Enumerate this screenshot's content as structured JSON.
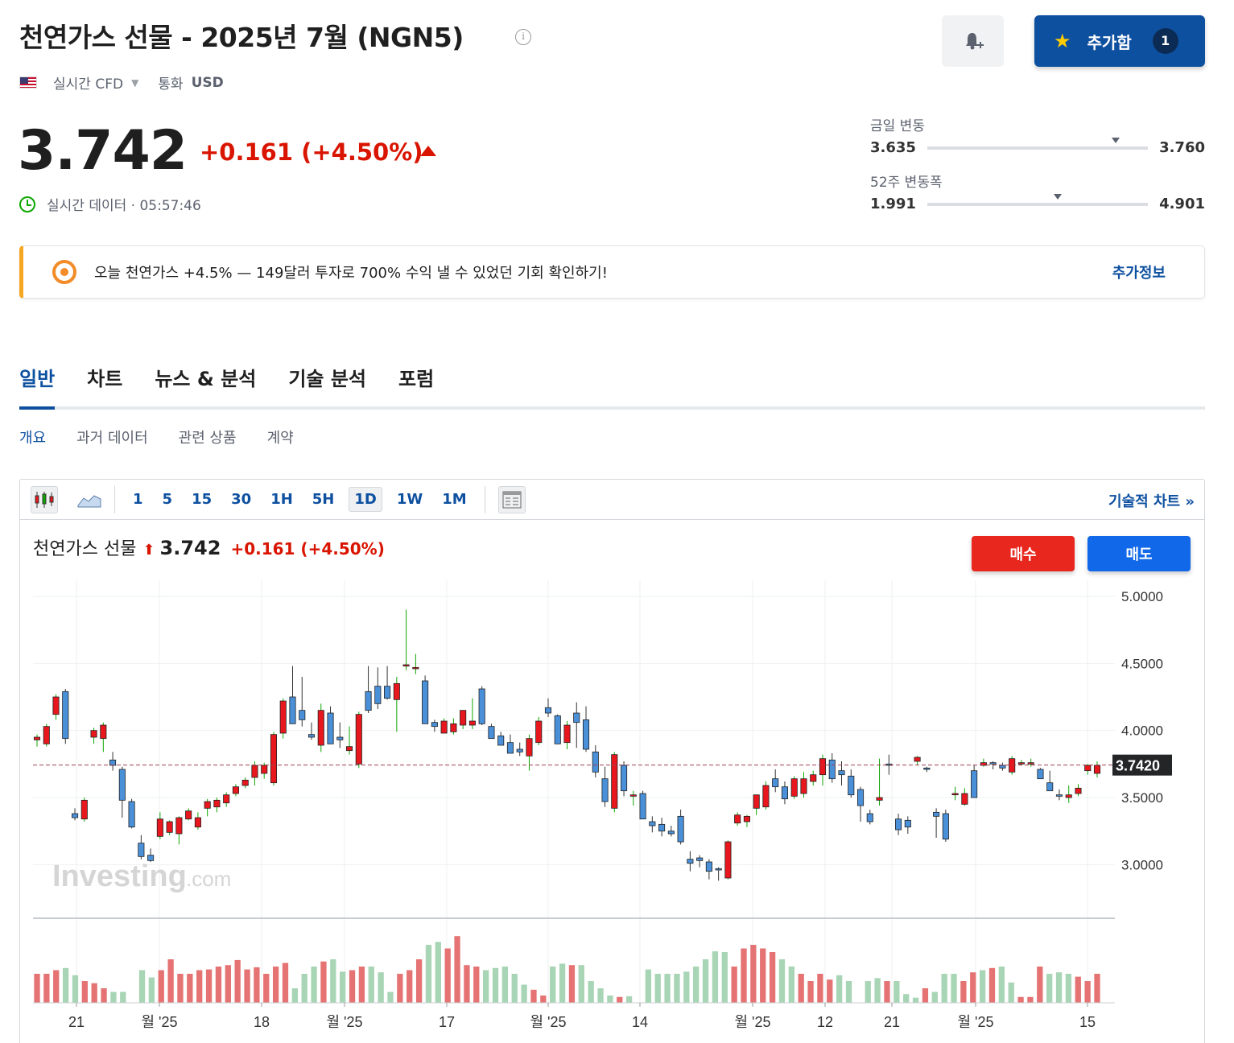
{
  "header": {
    "title": "천연가스 선물 - 2025년 7월 (NGN5)",
    "info_icon": "info-icon",
    "alert_icon": "bell-plus-icon",
    "watchlist_label": "추가함",
    "watchlist_count": "1",
    "watchlist_icon": "star-icon"
  },
  "subinfo": {
    "flag_icon": "us-flag-icon",
    "source": "실시간 CFD",
    "currency_label": "통화",
    "currency": "USD"
  },
  "quote": {
    "price": "3.742",
    "change": "+0.161 (+4.50%)",
    "realtime_label": "실시간 데이터 · 05:57:46"
  },
  "ranges": {
    "day_label": "금일 변동",
    "day_low": "3.635",
    "day_high": "3.760",
    "day_marker_fraction": 0.855,
    "week52_label": "52주 변동폭",
    "week52_low": "1.991",
    "week52_high": "4.901",
    "week52_marker_fraction": 0.59
  },
  "promo": {
    "text": "오늘 천연가스 +4.5% — 149달러 투자로 700% 수익 낼 수 있었던 기회 확인하기!",
    "link": "추가정보",
    "accent": "#f5a623"
  },
  "tabs": [
    "일반",
    "차트",
    "뉴스 & 분석",
    "기술 분석",
    "포럼"
  ],
  "subtabs": [
    "개요",
    "과거 데이터",
    "관련 상품",
    "계약"
  ],
  "chart_toolbar": {
    "timeframes": [
      "1",
      "5",
      "15",
      "30",
      "1H",
      "5H",
      "1D",
      "1W",
      "1M"
    ],
    "active_timeframe": "1D",
    "tech_chart_link": "기술적 차트 »"
  },
  "chart_header": {
    "name": "천연가스 선물",
    "price": "3.742",
    "change": "+0.161 (+4.50%)",
    "buy_label": "매수",
    "sell_label": "매도"
  },
  "colors": {
    "up_candle": "#e8171e",
    "down_candle": "#4a90d9",
    "volume_up": "#a8d5b5",
    "volume_down": "#e57373",
    "brand_blue": "#0e50a0",
    "change_red": "#d91400"
  },
  "chart_data": {
    "type": "candlestick",
    "y_ticks": [
      "5.0000",
      "4.5000",
      "4.0000",
      "3.5000",
      "3.0000"
    ],
    "y_range": [
      2.6,
      5.12
    ],
    "current_price_label": "3.7420",
    "current_price": 3.742,
    "x_tick_labels": [
      "21",
      "월 '25",
      "18",
      "월 '25",
      "17",
      "월 '25",
      "14",
      "월 '25",
      "12",
      "21",
      "월 '25",
      "15"
    ],
    "watermark": "Investing.com",
    "ohlc": [
      [
        3.93,
        3.97,
        3.88,
        3.95
      ],
      [
        3.9,
        4.05,
        3.88,
        4.03
      ],
      [
        4.12,
        4.27,
        4.08,
        4.25
      ],
      [
        4.29,
        4.31,
        3.9,
        3.94
      ],
      [
        3.38,
        3.42,
        3.33,
        3.35
      ],
      [
        3.34,
        3.5,
        3.32,
        3.48
      ],
      [
        3.95,
        4.02,
        3.9,
        4.0
      ],
      [
        3.94,
        4.06,
        3.84,
        4.04
      ],
      [
        3.78,
        3.84,
        3.7,
        3.74
      ],
      [
        3.71,
        3.73,
        3.35,
        3.48
      ],
      [
        3.47,
        3.49,
        3.27,
        3.28
      ],
      [
        3.16,
        3.22,
        3.04,
        3.06
      ],
      [
        3.07,
        3.12,
        3.02,
        3.03
      ],
      [
        3.21,
        3.39,
        3.19,
        3.34
      ],
      [
        3.24,
        3.33,
        3.22,
        3.32
      ],
      [
        3.23,
        3.36,
        3.15,
        3.35
      ],
      [
        3.34,
        3.42,
        3.33,
        3.4
      ],
      [
        3.28,
        3.39,
        3.26,
        3.35
      ],
      [
        3.42,
        3.49,
        3.36,
        3.47
      ],
      [
        3.43,
        3.5,
        3.39,
        3.48
      ],
      [
        3.46,
        3.54,
        3.43,
        3.52
      ],
      [
        3.53,
        3.6,
        3.51,
        3.58
      ],
      [
        3.59,
        3.65,
        3.57,
        3.63
      ],
      [
        3.65,
        3.77,
        3.59,
        3.74
      ],
      [
        3.68,
        3.76,
        3.64,
        3.74
      ],
      [
        3.61,
        3.99,
        3.59,
        3.97
      ],
      [
        3.98,
        4.24,
        3.94,
        4.22
      ],
      [
        4.25,
        4.48,
        4.2,
        4.05
      ],
      [
        4.15,
        4.4,
        4.03,
        4.08
      ],
      [
        3.97,
        4.06,
        3.93,
        3.95
      ],
      [
        3.89,
        4.2,
        3.84,
        4.15
      ],
      [
        4.13,
        4.18,
        3.97,
        3.9
      ],
      [
        3.95,
        4.06,
        3.87,
        3.93
      ],
      [
        3.85,
        4.03,
        3.82,
        3.88
      ],
      [
        3.75,
        4.14,
        3.72,
        4.12
      ],
      [
        4.29,
        4.48,
        4.13,
        4.15
      ],
      [
        4.33,
        4.47,
        4.16,
        4.2
      ],
      [
        4.33,
        4.48,
        4.23,
        4.24
      ],
      [
        4.23,
        4.4,
        3.99,
        4.35
      ],
      [
        4.48,
        4.9,
        4.45,
        4.49
      ],
      [
        4.46,
        4.57,
        4.42,
        4.47
      ],
      [
        4.37,
        4.41,
        4.08,
        4.05
      ],
      [
        4.06,
        4.08,
        3.99,
        4.03
      ],
      [
        3.98,
        4.09,
        3.98,
        4.07
      ],
      [
        3.99,
        4.09,
        3.97,
        4.05
      ],
      [
        4.04,
        4.09,
        4.01,
        4.15
      ],
      [
        4.04,
        4.24,
        4.01,
        4.07
      ],
      [
        4.31,
        4.33,
        4.04,
        4.05
      ],
      [
        4.03,
        4.05,
        4.02,
        3.94
      ],
      [
        3.96,
        3.99,
        3.91,
        3.89
      ],
      [
        3.91,
        3.97,
        3.84,
        3.83
      ],
      [
        3.86,
        3.91,
        3.81,
        3.84
      ],
      [
        3.81,
        3.97,
        3.7,
        3.94
      ],
      [
        3.91,
        4.1,
        3.89,
        4.07
      ],
      [
        4.17,
        4.24,
        4.1,
        4.13
      ],
      [
        4.11,
        4.12,
        3.9,
        3.9
      ],
      [
        3.91,
        4.07,
        3.86,
        4.04
      ],
      [
        4.13,
        4.21,
        3.87,
        4.06
      ],
      [
        4.08,
        4.18,
        3.84,
        3.86
      ],
      [
        3.84,
        3.89,
        3.65,
        3.69
      ],
      [
        3.64,
        3.73,
        3.43,
        3.47
      ],
      [
        3.42,
        3.84,
        3.39,
        3.82
      ],
      [
        3.74,
        3.77,
        3.51,
        3.55
      ],
      [
        3.51,
        3.55,
        3.44,
        3.52
      ],
      [
        3.53,
        3.55,
        3.35,
        3.34
      ],
      [
        3.32,
        3.36,
        3.24,
        3.29
      ],
      [
        3.3,
        3.35,
        3.21,
        3.25
      ],
      [
        3.25,
        3.29,
        3.21,
        3.23
      ],
      [
        3.36,
        3.41,
        3.15,
        3.17
      ],
      [
        3.04,
        3.1,
        2.95,
        3.01
      ],
      [
        3.05,
        3.07,
        2.98,
        3.03
      ],
      [
        3.02,
        3.04,
        2.89,
        2.95
      ],
      [
        2.97,
        2.98,
        2.88,
        2.96
      ],
      [
        2.9,
        3.18,
        2.89,
        3.17
      ],
      [
        3.31,
        3.39,
        3.29,
        3.37
      ],
      [
        3.32,
        3.37,
        3.28,
        3.36
      ],
      [
        3.42,
        3.47,
        3.37,
        3.52
      ],
      [
        3.43,
        3.62,
        3.41,
        3.59
      ],
      [
        3.64,
        3.71,
        3.54,
        3.58
      ],
      [
        3.58,
        3.62,
        3.45,
        3.49
      ],
      [
        3.51,
        3.66,
        3.49,
        3.64
      ],
      [
        3.53,
        3.69,
        3.5,
        3.64
      ],
      [
        3.62,
        3.7,
        3.59,
        3.67
      ],
      [
        3.67,
        3.82,
        3.59,
        3.79
      ],
      [
        3.78,
        3.83,
        3.61,
        3.64
      ],
      [
        3.7,
        3.77,
        3.59,
        3.67
      ],
      [
        3.66,
        3.71,
        3.5,
        3.52
      ],
      [
        3.56,
        3.58,
        3.32,
        3.44
      ],
      [
        3.38,
        3.41,
        3.3,
        3.32
      ],
      [
        3.48,
        3.79,
        3.44,
        3.5
      ],
      [
        3.75,
        3.82,
        3.67,
        3.74
      ],
      [
        3.34,
        3.38,
        3.22,
        3.26
      ],
      [
        3.33,
        3.36,
        3.23,
        3.28
      ],
      [
        3.77,
        3.81,
        3.74,
        3.8
      ],
      [
        3.72,
        3.73,
        3.69,
        3.71
      ],
      [
        3.39,
        3.42,
        3.2,
        3.36
      ],
      [
        3.38,
        3.41,
        3.17,
        3.19
      ],
      [
        3.52,
        3.58,
        3.48,
        3.53
      ],
      [
        3.45,
        3.57,
        3.44,
        3.53
      ],
      [
        3.7,
        3.74,
        3.54,
        3.5
      ],
      [
        3.74,
        3.79,
        3.73,
        3.76
      ],
      [
        3.76,
        3.77,
        3.71,
        3.75
      ],
      [
        3.74,
        3.76,
        3.7,
        3.72
      ],
      [
        3.69,
        3.81,
        3.67,
        3.79
      ],
      [
        3.75,
        3.78,
        3.74,
        3.76
      ],
      [
        3.75,
        3.79,
        3.73,
        3.76
      ],
      [
        3.71,
        3.72,
        3.68,
        3.64
      ],
      [
        3.61,
        3.7,
        3.55,
        3.55
      ],
      [
        3.52,
        3.56,
        3.48,
        3.51
      ],
      [
        3.5,
        3.59,
        3.46,
        3.52
      ],
      [
        3.53,
        3.6,
        3.51,
        3.57
      ],
      [
        3.7,
        3.75,
        3.67,
        3.74
      ],
      [
        3.68,
        3.77,
        3.65,
        3.74
      ]
    ],
    "volume_fraction": [
      0.4,
      0.4,
      0.45,
      0.48,
      0.38,
      0.3,
      0.27,
      0.2,
      0.15,
      0.15,
      0.0,
      0.45,
      0.35,
      0.45,
      0.6,
      0.4,
      0.4,
      0.45,
      0.46,
      0.5,
      0.52,
      0.59,
      0.46,
      0.49,
      0.4,
      0.5,
      0.55,
      0.2,
      0.4,
      0.5,
      0.57,
      0.6,
      0.43,
      0.45,
      0.5,
      0.5,
      0.42,
      0.15,
      0.4,
      0.45,
      0.6,
      0.8,
      0.84,
      0.75,
      0.92,
      0.52,
      0.5,
      0.45,
      0.48,
      0.5,
      0.4,
      0.25,
      0.18,
      0.1,
      0.5,
      0.54,
      0.52,
      0.52,
      0.3,
      0.2,
      0.1,
      0.08,
      0.09,
      0.0,
      0.46,
      0.4,
      0.4,
      0.4,
      0.43,
      0.5,
      0.6,
      0.71,
      0.7,
      0.5,
      0.75,
      0.8,
      0.75,
      0.7,
      0.6,
      0.5,
      0.4,
      0.3,
      0.4,
      0.32,
      0.38,
      0.3,
      0.0,
      0.3,
      0.34,
      0.3,
      0.3,
      0.12,
      0.07,
      0.2,
      0.15,
      0.4,
      0.4,
      0.3,
      0.42,
      0.45,
      0.48,
      0.5,
      0.28,
      0.08,
      0.08,
      0.5,
      0.4,
      0.42,
      0.4,
      0.36,
      0.3,
      0.4
    ]
  }
}
